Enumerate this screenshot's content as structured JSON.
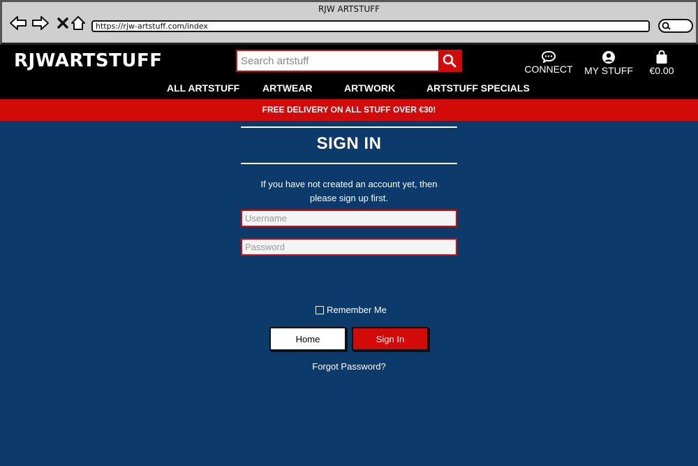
{
  "browser": {
    "title": "RJW ARTSTUFF",
    "url": "https://rjw-artstuff.com/index"
  },
  "header": {
    "logo": "RJWARTSTUFF",
    "search_placeholder": "Search artstuff",
    "connect_label": "CONNECT",
    "my_stuff_label": "MY STUFF",
    "cart_total": "€0.00"
  },
  "nav": {
    "items": [
      "ALL ARTSTUFF",
      "ARTWEAR",
      "ARTWORK",
      "ARTSTUFF SPECIALS"
    ]
  },
  "promo": {
    "text": "FREE DELIVERY ON ALL STUFF OVER €30!"
  },
  "signin": {
    "title": "SIGN IN",
    "info_line1": "If you have not created an account yet, then",
    "info_line2": "please sign up first.",
    "username_placeholder": "Username",
    "password_placeholder": "Password",
    "remember_label": "Remember Me",
    "home_button": "Home",
    "signin_button": "Sign In",
    "forgot_link": "Forgot Password?"
  },
  "colors": {
    "accent": "#d20a0a",
    "background": "#0c3a6b",
    "header": "#000000"
  }
}
